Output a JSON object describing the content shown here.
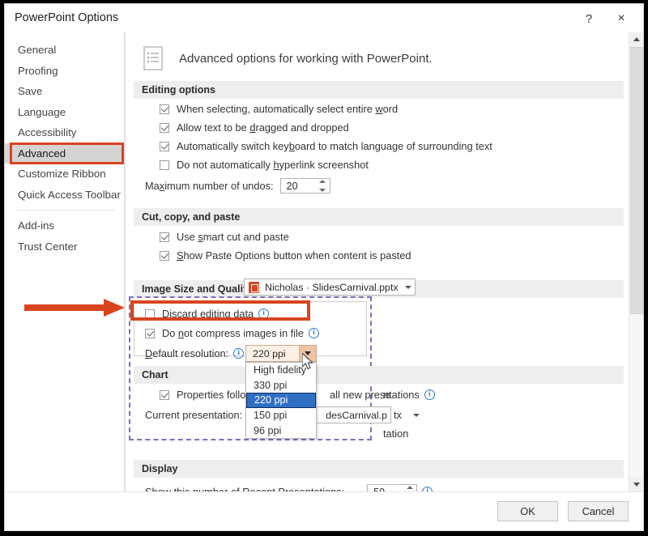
{
  "window": {
    "title": "PowerPoint Options",
    "help_label": "?",
    "close_label": "×"
  },
  "sidebar": {
    "items": [
      {
        "label": "General",
        "selected": false
      },
      {
        "label": "Proofing",
        "selected": false
      },
      {
        "label": "Save",
        "selected": false
      },
      {
        "label": "Language",
        "selected": false
      },
      {
        "label": "Accessibility",
        "selected": false
      },
      {
        "label": "Advanced",
        "selected": true
      },
      {
        "label": "Customize Ribbon",
        "selected": false
      },
      {
        "label": "Quick Access Toolbar",
        "selected": false
      },
      {
        "label": "Add-ins",
        "selected": false
      },
      {
        "label": "Trust Center",
        "selected": false
      }
    ]
  },
  "pane": {
    "header": "Advanced options for working with PowerPoint.",
    "sections": {
      "editing": {
        "title": "Editing options",
        "options": [
          {
            "label": "When selecting, automatically select entire word",
            "checked": true
          },
          {
            "label": "Allow text to be dragged and dropped",
            "checked": true
          },
          {
            "label": "Automatically switch keyboard to match language of surrounding text",
            "checked": true
          },
          {
            "label": "Do not automatically hyperlink screenshot",
            "checked": false
          }
        ],
        "undos_label": "Maximum number of undos:",
        "undos_value": "20"
      },
      "paste": {
        "title": "Cut, copy, and paste",
        "options": [
          {
            "label": "Use smart cut and paste",
            "checked": true
          },
          {
            "label": "Show Paste Options button when content is pasted",
            "checked": true
          }
        ]
      },
      "image": {
        "title": "Image Size and Quality",
        "file_label": "Nicholas · SlidesCarnival.pptx",
        "options": [
          {
            "label": "Discard editing data",
            "checked": false
          },
          {
            "label": "Do not compress images in file",
            "checked": true
          }
        ],
        "resolution_label": "Default resolution:",
        "resolution_value": "220 ppi",
        "resolution_options": [
          {
            "label": "High fidelity",
            "selected": false
          },
          {
            "label": "330 ppi",
            "selected": false
          },
          {
            "label": "220 ppi",
            "selected": true
          },
          {
            "label": "150 ppi",
            "selected": false
          },
          {
            "label": "96 ppi",
            "selected": false
          }
        ]
      },
      "chart": {
        "title": "Chart",
        "properties_label_left": "Properties follow ch",
        "properties_label_right": "all new prese",
        "properties_label_tail": "ntations",
        "current_label": "Current presentation:",
        "current_value_tail": "desCarnival.p",
        "current_value_end": "tx",
        "tail_text": "tation"
      },
      "display": {
        "title": "Display",
        "recent_label": "Show this number of Recent Presentations:",
        "recent_value": "50"
      }
    }
  },
  "footer": {
    "ok_label": "OK",
    "cancel_label": "Cancel"
  },
  "annotations": {
    "advanced_box_color": "#d9441f",
    "discard_box_color": "#d9441f",
    "arrow_color": "#d9441f",
    "selection_dash_color": "#7b6fc4",
    "dropdown_highlight_color": "#2f6fc4"
  }
}
